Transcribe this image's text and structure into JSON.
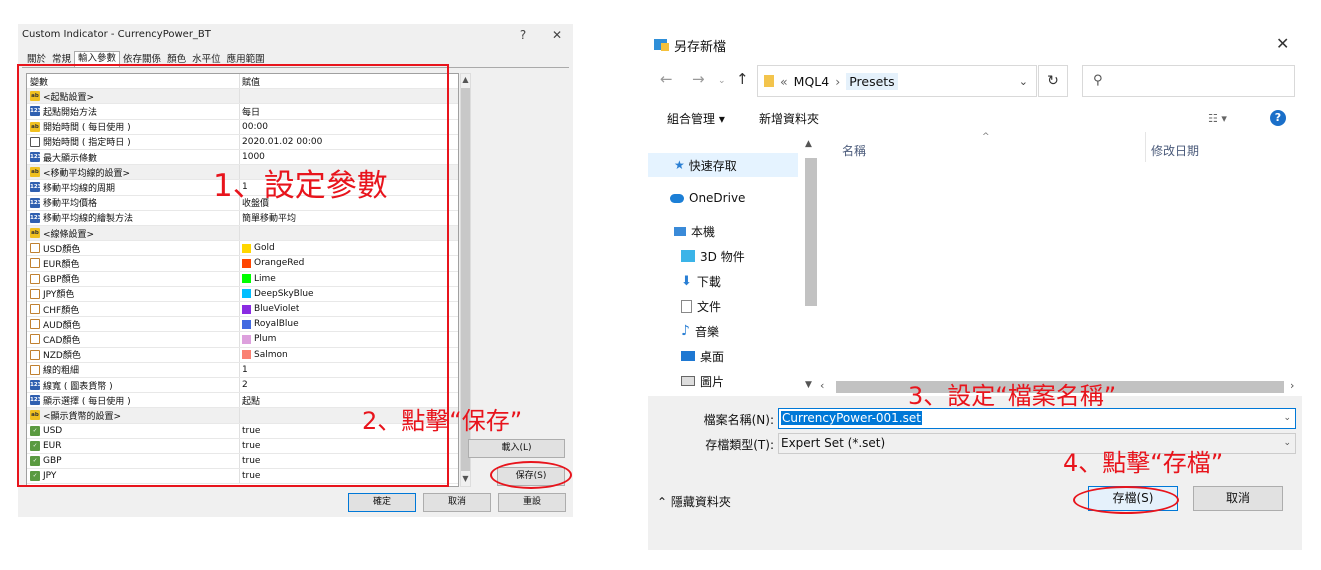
{
  "left_dialog": {
    "title": "Custom Indicator - CurrencyPower_BT",
    "help": "?",
    "close": "✕",
    "tabs": [
      "關於",
      "常規",
      "輸入參數",
      "依存關係",
      "顏色",
      "水平位",
      "應用範圍"
    ],
    "columns": [
      "變數",
      "賦值"
    ],
    "rows": [
      {
        "icon": "ab",
        "name": "<起點設置>",
        "value": "",
        "group": true
      },
      {
        "icon": "123",
        "name": "起點開始方法",
        "value": "每日"
      },
      {
        "icon": "ab",
        "name": "開始時間 ( 每日使用 )",
        "value": "00:00"
      },
      {
        "icon": "cal",
        "name": "開始時間 ( 指定時日 )",
        "value": "2020.01.02 00:00"
      },
      {
        "icon": "123",
        "name": "最大顯示條數",
        "value": "1000"
      },
      {
        "icon": "ab",
        "name": "<移動平均線的設置>",
        "value": "",
        "group": true
      },
      {
        "icon": "123",
        "name": "移動平均線的周期",
        "value": "1"
      },
      {
        "icon": "123",
        "name": "移動平均價格",
        "value": "收盤價"
      },
      {
        "icon": "123",
        "name": "移動平均線的繪製方法",
        "value": "簡單移動平均"
      },
      {
        "icon": "ab",
        "name": "<線條設置>",
        "value": "",
        "group": true
      },
      {
        "icon": "color",
        "name": "USD顏色",
        "value": "Gold",
        "swatch": "#FFD700"
      },
      {
        "icon": "color",
        "name": "EUR顏色",
        "value": "OrangeRed",
        "swatch": "#FF4500"
      },
      {
        "icon": "color",
        "name": "GBP顏色",
        "value": "Lime",
        "swatch": "#00FF00"
      },
      {
        "icon": "color",
        "name": "JPY顏色",
        "value": "DeepSkyBlue",
        "swatch": "#00BFFF"
      },
      {
        "icon": "color",
        "name": "CHF顏色",
        "value": "BlueViolet",
        "swatch": "#8A2BE2"
      },
      {
        "icon": "color",
        "name": "AUD顏色",
        "value": "RoyalBlue",
        "swatch": "#4169E1"
      },
      {
        "icon": "color",
        "name": "CAD顏色",
        "value": "Plum",
        "swatch": "#DDA0DD"
      },
      {
        "icon": "color",
        "name": "NZD顏色",
        "value": "Salmon",
        "swatch": "#FA8072"
      },
      {
        "icon": "color",
        "name": "線的粗細",
        "value": "1"
      },
      {
        "icon": "123",
        "name": "線寬 ( 圖表貨幣 )",
        "value": "2"
      },
      {
        "icon": "123",
        "name": "顯示選擇 ( 每日使用 )",
        "value": "起點"
      },
      {
        "icon": "ab",
        "name": "<顯示貨幣的設置>",
        "value": "",
        "group": true
      },
      {
        "icon": "bool",
        "name": "USD",
        "value": "true"
      },
      {
        "icon": "bool",
        "name": "EUR",
        "value": "true"
      },
      {
        "icon": "bool",
        "name": "GBP",
        "value": "true"
      },
      {
        "icon": "bool",
        "name": "JPY",
        "value": "true"
      }
    ],
    "load_button": "載入(L)",
    "save_button": "保存(S)",
    "ok_button": "確定",
    "cancel_button": "取消",
    "reset_button": "重設"
  },
  "save_dialog": {
    "title": "另存新檔",
    "close": "✕",
    "path": [
      "MQL4",
      "Presets"
    ],
    "path_prefix": "«",
    "refresh": "↻",
    "search_icon": "⚲",
    "toolbar": {
      "organize": "組合管理 ▾",
      "new_folder": "新增資料夾",
      "view": "☷ ▾",
      "help": "?"
    },
    "nav_items": [
      "快速存取",
      "OneDrive",
      "本機",
      "3D 物件",
      "下載",
      "文件",
      "音樂",
      "桌面",
      "圖片"
    ],
    "columns": {
      "name": "名稱",
      "modified": "修改日期"
    },
    "filename_label": "檔案名稱(N):",
    "filename_value": "CurrencyPower-001.set",
    "filetype_label": "存檔類型(T):",
    "filetype_value": "Expert Set (*.set)",
    "hide_folders": "隱藏資料夾",
    "save_button": "存檔(S)",
    "cancel_button": "取消"
  },
  "annotations": {
    "step1": "1、設定參數",
    "step2": "2、點擊“保存”",
    "step3": "3、設定“檔案名稱”",
    "step4": "4、點擊“存檔”"
  },
  "colors": {
    "annotation_red": "#e8141c",
    "accent_blue": "#0078d7"
  }
}
